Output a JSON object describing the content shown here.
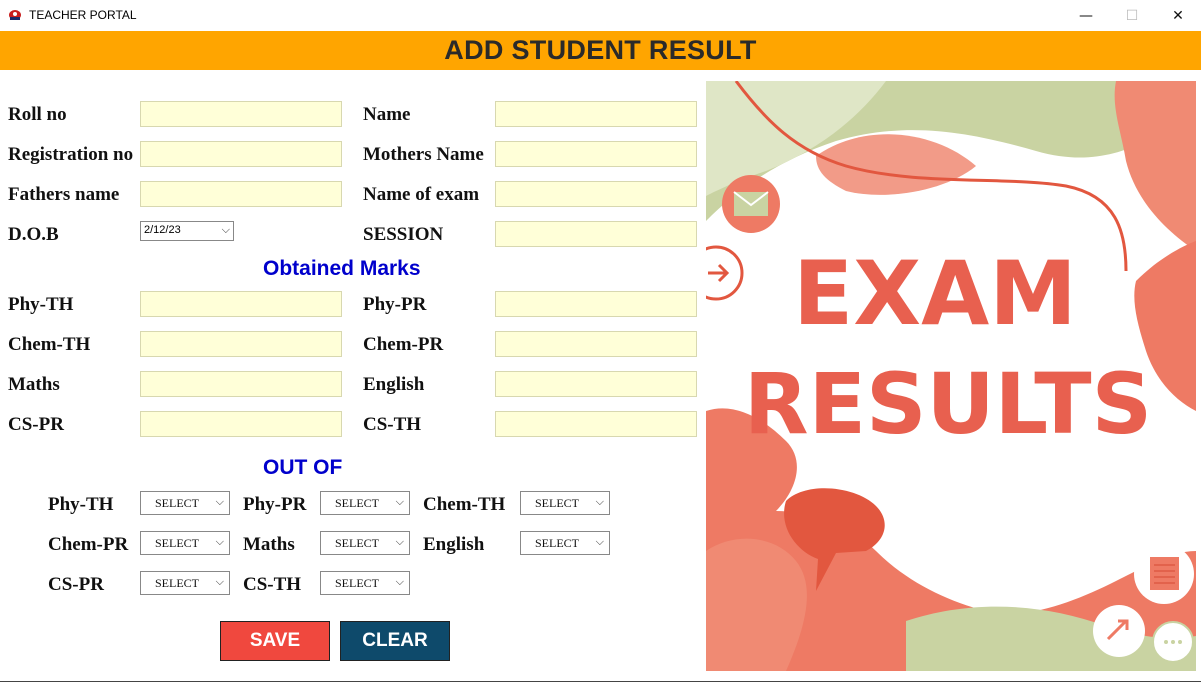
{
  "window": {
    "title": "TEACHER PORTAL",
    "minimize": "—",
    "maximize": "☐",
    "close": "✕"
  },
  "banner": {
    "title": "ADD STUDENT RESULT"
  },
  "student": {
    "roll_no_label": "Roll no",
    "name_label": "Name",
    "registration_no_label": "Registration no",
    "mothers_name_label": "Mothers Name",
    "fathers_name_label": "Fathers name",
    "name_of_exam_label": "Name of exam",
    "dob_label": "D.O.B",
    "dob_value": "2/12/23",
    "session_label": "SESSION"
  },
  "obtained": {
    "heading": "Obtained Marks",
    "phy_th": "Phy-TH",
    "phy_pr": "Phy-PR",
    "chem_th": "Chem-TH",
    "chem_pr": "Chem-PR",
    "maths": "Maths",
    "english": "English",
    "cs_pr": "CS-PR",
    "cs_th": "CS-TH"
  },
  "outof": {
    "heading": "OUT OF",
    "phy_th": "Phy-TH",
    "phy_pr": "Phy-PR",
    "chem_th": "Chem-TH",
    "chem_pr": "Chem-PR",
    "maths": "Maths",
    "english": "English",
    "cs_pr": "CS-PR",
    "cs_th": "CS-TH",
    "select_placeholder": "SELECT"
  },
  "buttons": {
    "save": "SAVE",
    "clear": "CLEAR"
  },
  "artwork": {
    "line1": "EXAM",
    "line2": "RESULTS"
  },
  "colors": {
    "banner": "#ffa500",
    "field_bg": "#ffffd8",
    "section": "#0000cc",
    "save": "#f0483e",
    "clear": "#0e4a6b",
    "art_text": "#e8604f"
  }
}
